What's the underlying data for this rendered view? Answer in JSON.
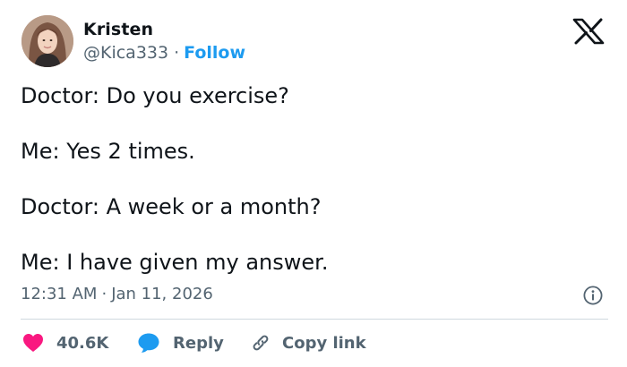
{
  "author": {
    "display_name": "Kristen",
    "handle": "@Kica333",
    "separator": "·",
    "follow_label": "Follow"
  },
  "tweet": {
    "lines": [
      "Doctor: Do you exercise?",
      "Me: Yes 2 times.",
      "Doctor: A week or a month?",
      "Me: I have given my answer."
    ],
    "time": "12:31 AM",
    "separator": "·",
    "date": "Jan 11, 2026"
  },
  "actions": {
    "like_count": "40.6K",
    "reply_label": "Reply",
    "copy_label": "Copy link"
  },
  "colors": {
    "like_heart": "#f91880",
    "reply_bubble": "#1d9bf0",
    "follow_link": "#1d9bf0",
    "secondary_text": "#536471"
  },
  "icons": {
    "logo": "x-logo-icon",
    "info": "info-icon",
    "like": "heart-icon",
    "reply": "speech-bubble-icon",
    "copy": "link-icon"
  }
}
